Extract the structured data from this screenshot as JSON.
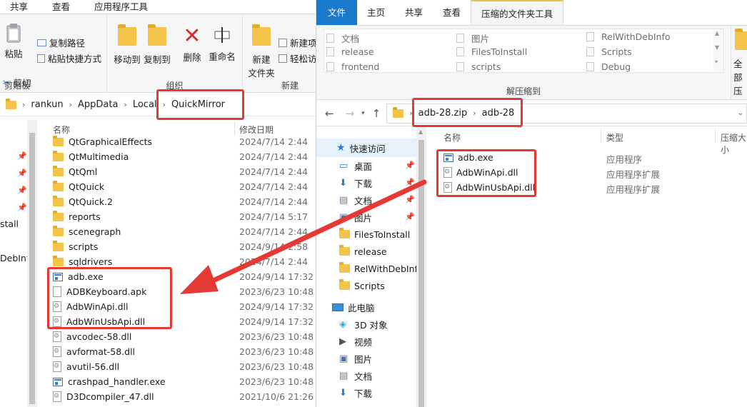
{
  "left": {
    "tabs": [
      "共享",
      "查看",
      "应用程序工具"
    ],
    "ribbon": {
      "clipboard": {
        "paste": "粘贴",
        "copy_path": "复制路径",
        "paste_shortcut": "粘贴快捷方式",
        "cut": "剪切",
        "label": "剪贴板"
      },
      "organize": {
        "move_to": "移动到",
        "copy_to": "复制到",
        "delete": "删除",
        "rename": "重命名",
        "label": "组织"
      },
      "new": {
        "new_folder_1": "新建",
        "new_folder_2": "文件夹",
        "new_item": "新建项",
        "easy_access": "轻松访",
        "label": "新建"
      }
    },
    "breadcrumb": [
      "rankun",
      "AppData",
      "Local",
      "QuickMirror"
    ],
    "columns": {
      "name": "名称",
      "date": "修改日期"
    },
    "nav_fragments": [
      "stall",
      "DebInfo"
    ],
    "files": [
      {
        "name": "QtGraphicalEffects",
        "date": "2024/7/14 2:44",
        "type": "folder"
      },
      {
        "name": "QtMultimedia",
        "date": "2024/7/14 2:44",
        "type": "folder"
      },
      {
        "name": "QtQml",
        "date": "2024/7/14 2:44",
        "type": "folder"
      },
      {
        "name": "QtQuick",
        "date": "2024/7/14 2:44",
        "type": "folder"
      },
      {
        "name": "QtQuick.2",
        "date": "2024/7/14 2:44",
        "type": "folder"
      },
      {
        "name": "reports",
        "date": "2024/7/14 5:17",
        "type": "folder"
      },
      {
        "name": "scenegraph",
        "date": "2024/7/14 2:44",
        "type": "folder"
      },
      {
        "name": "scripts",
        "date": "2024/9/14 2:58",
        "type": "folder"
      },
      {
        "name": "sqldrivers",
        "date": "2024/7/14 2:44",
        "type": "folder"
      },
      {
        "name": "adb.exe",
        "date": "2024/9/14 17:32",
        "type": "exe"
      },
      {
        "name": "ADBKeyboard.apk",
        "date": "2023/6/23 10:48",
        "type": "doc"
      },
      {
        "name": "AdbWinApi.dll",
        "date": "2024/9/14 17:32",
        "type": "dll"
      },
      {
        "name": "AdbWinUsbApi.dll",
        "date": "2024/9/14 17:32",
        "type": "dll"
      },
      {
        "name": "avcodec-58.dll",
        "date": "2023/6/23 10:48",
        "type": "dll"
      },
      {
        "name": "avformat-58.dll",
        "date": "2023/6/23 10:48",
        "type": "dll"
      },
      {
        "name": "avutil-56.dll",
        "date": "2023/6/23 10:48",
        "type": "dll"
      },
      {
        "name": "crashpad_handler.exe",
        "date": "2023/6/23 10:48",
        "type": "exe"
      },
      {
        "name": "D3Dcompiler_47.dll",
        "date": "2021/10/6 21:26",
        "type": "dll"
      }
    ]
  },
  "right": {
    "tabs": [
      "文件",
      "主页",
      "共享",
      "查看",
      "压缩的文件夹工具"
    ],
    "extract_label": "解压缩到",
    "extract_targets": [
      [
        "文档",
        "图片",
        "RelWithDebInfo"
      ],
      [
        "release",
        "FilesToInstall",
        "Scripts"
      ],
      [
        "frontend",
        "scripts",
        "Debug"
      ]
    ],
    "extract_all_1": "全部",
    "extract_all_2": "压",
    "breadcrumb": [
      "adb-28.zip",
      "adb-28"
    ],
    "columns": {
      "name": "名称",
      "type": "类型",
      "compressed": "压缩大小"
    },
    "nav": {
      "quick_access": "快速访问",
      "items": [
        {
          "label": "桌面",
          "icon": "desktop"
        },
        {
          "label": "下载",
          "icon": "download"
        },
        {
          "label": "文档",
          "icon": "document"
        },
        {
          "label": "图片",
          "icon": "picture"
        },
        {
          "label": "FilesToInstall",
          "icon": "folder"
        },
        {
          "label": "release",
          "icon": "folder"
        },
        {
          "label": "RelWithDebInfo",
          "icon": "folder"
        },
        {
          "label": "Scripts",
          "icon": "folder"
        }
      ],
      "this_pc": "此电脑",
      "pc_items": [
        {
          "label": "3D 对象",
          "icon": "3d"
        },
        {
          "label": "视频",
          "icon": "video"
        },
        {
          "label": "图片",
          "icon": "picture"
        },
        {
          "label": "文档",
          "icon": "document"
        },
        {
          "label": "下载",
          "icon": "download"
        }
      ]
    },
    "files": [
      {
        "name": "adb.exe",
        "type": "应用程序",
        "icon": "exe"
      },
      {
        "name": "AdbWinApi.dll",
        "type": "应用程序扩展",
        "icon": "dll"
      },
      {
        "name": "AdbWinUsbApi.dll",
        "type": "应用程序扩展",
        "icon": "dll"
      }
    ]
  },
  "colors": {
    "accent": "#1979ca",
    "highlight": "#e53935",
    "folder": "#f3c449"
  }
}
